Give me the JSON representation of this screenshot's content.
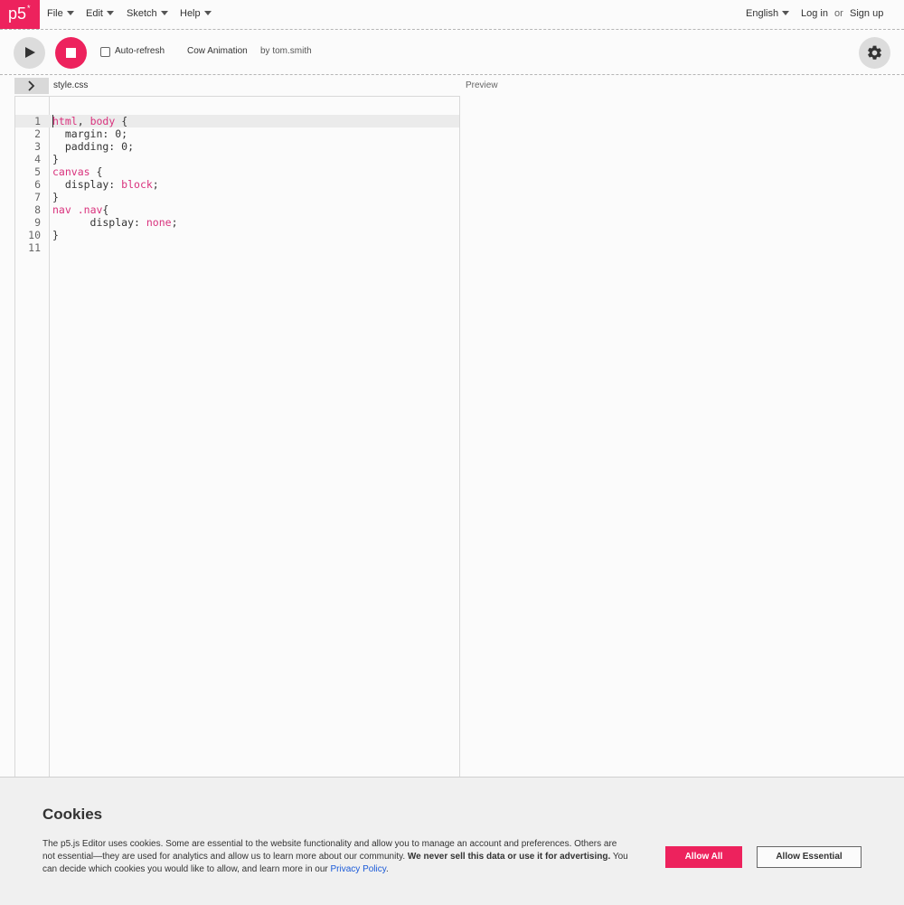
{
  "nav": {
    "logo_text": "p5",
    "logo_mark": "*",
    "menus": [
      "File",
      "Edit",
      "Sketch",
      "Help"
    ],
    "language": "English",
    "login": "Log in",
    "or": "or",
    "signup": "Sign up"
  },
  "toolbar": {
    "auto_refresh_label": "Auto-refresh",
    "auto_refresh_checked": false,
    "project_name": "Cow Animation",
    "owner": "by tom.smith"
  },
  "editor": {
    "file_name": "style.css",
    "preview_label": "Preview",
    "lines": [
      {
        "n": "1",
        "parts": [
          [
            "kw",
            "html"
          ],
          [
            "p",
            ", "
          ],
          [
            "kw",
            "body"
          ],
          [
            "p",
            " {"
          ]
        ]
      },
      {
        "n": "2",
        "parts": [
          [
            "p",
            "  margin: 0;"
          ]
        ]
      },
      {
        "n": "3",
        "parts": [
          [
            "p",
            "  padding: 0;"
          ]
        ]
      },
      {
        "n": "4",
        "parts": [
          [
            "p",
            "}"
          ]
        ]
      },
      {
        "n": "5",
        "parts": [
          [
            "kw",
            "canvas"
          ],
          [
            "p",
            " {"
          ]
        ]
      },
      {
        "n": "6",
        "parts": [
          [
            "p",
            "  display: "
          ],
          [
            "kw",
            "block"
          ],
          [
            "p",
            ";"
          ]
        ]
      },
      {
        "n": "7",
        "parts": [
          [
            "p",
            "}"
          ]
        ]
      },
      {
        "n": "8",
        "parts": [
          [
            "kw",
            "nav"
          ],
          [
            "p",
            " "
          ],
          [
            "cls",
            ".nav"
          ],
          [
            "p",
            "{"
          ]
        ]
      },
      {
        "n": "9",
        "parts": [
          [
            "p",
            "      display: "
          ],
          [
            "kw",
            "none"
          ],
          [
            "p",
            ";"
          ]
        ]
      },
      {
        "n": "10",
        "parts": [
          [
            "p",
            "}"
          ]
        ]
      },
      {
        "n": "11",
        "parts": []
      }
    ]
  },
  "cookies": {
    "title": "Cookies",
    "text_1": "The p5.js Editor uses cookies. Some are essential to the website functionality and allow you to manage an account and preferences. Others are not essential—they are used for analytics and allow us to learn more about our community. ",
    "text_bold": "We never sell this data or use it for advertising.",
    "text_2": " You can decide which cookies you would like to allow, and learn more in our ",
    "privacy_link": "Privacy Policy",
    "text_end": ".",
    "allow_all": "Allow All",
    "allow_essential": "Allow Essential"
  },
  "colors": {
    "accent": "#ed225d",
    "link": "#1a5ad8"
  }
}
